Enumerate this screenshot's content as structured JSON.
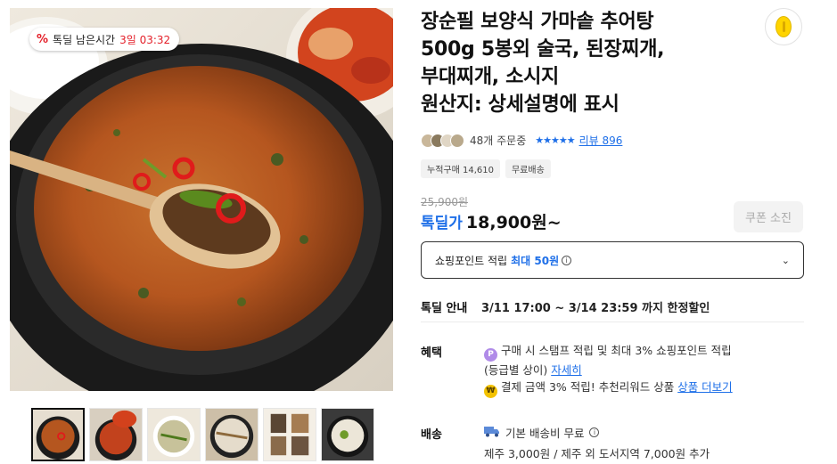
{
  "product": {
    "deal_badge": {
      "icon": "percent-icon",
      "label": "톡딜 남은시간",
      "timer": "3일 03:32"
    },
    "title_lines": [
      "장순필 보양식 가마솥 추어탕",
      "500g 5봉외 술국, 된장찌개,",
      "부대찌개, 소시지",
      "원산지: 상세설명에 표시"
    ],
    "order_count": "48개 주문중",
    "rating_stars": "★★★★★",
    "review_link": "리뷰 896",
    "chips": [
      "누적구매 14,610",
      "무료배송"
    ],
    "original_price": "25,900원",
    "deal_label": "톡딜가",
    "price": "18,900원~",
    "coupon_button": "쿠폰 소진",
    "points": {
      "label": "쇼핑포인트 적립",
      "max": "최대 50원",
      "info_icon": "i"
    },
    "deal_info": {
      "label": "톡딜 안내",
      "text": "3/11 17:00 ~ 3/14 23:59 까지 한정할인"
    },
    "benefits": {
      "label": "혜택",
      "line1": "구매 시 스탬프 적립 및 최대 3% 쇼핑포인트 적립",
      "line1b": "(등급별 상이)",
      "line1_link": "자세히",
      "line1_icon": "P",
      "line2": "결제 금액 3% 적립! 추천리워드 상품",
      "line2_link": "상품 더보기",
      "line2_icon": "₩"
    },
    "shipping": {
      "label": "배송",
      "line1": "기본 배송비 무료",
      "line2": "제주 3,000원 / 제주 외 도서지역 7,000원 추가"
    }
  },
  "colors": {
    "accent_blue": "#1e6fe8",
    "deal_red": "#e4202a"
  }
}
